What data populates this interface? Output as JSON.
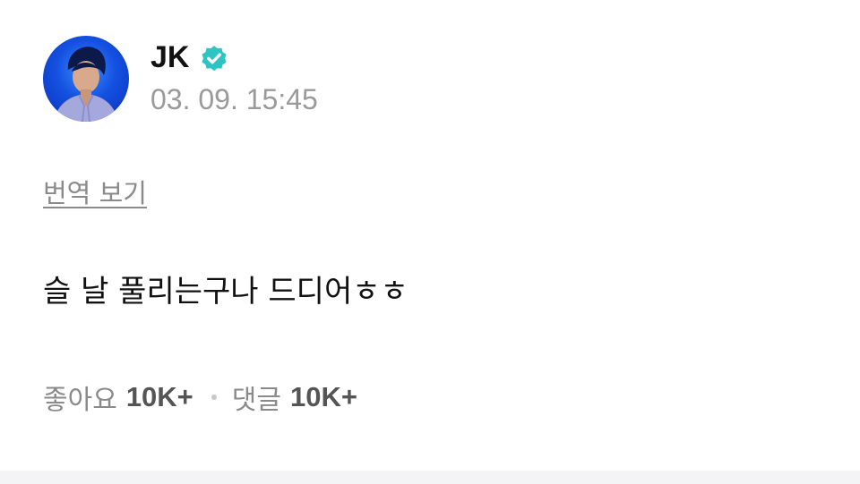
{
  "author": {
    "name": "JK",
    "verified_icon": "verified-badge-icon",
    "verified_color": "#2ec4c4",
    "avatar_bg_color": "#1450e0"
  },
  "post": {
    "timestamp": "03. 09. 15:45",
    "translate_label": "번역 보기",
    "body": "슬 날 풀리는구나 드디어ㅎㅎ"
  },
  "stats": {
    "likes_label": "좋아요",
    "likes_count": "10K+",
    "comments_label": "댓글",
    "comments_count": "10K+"
  },
  "colors": {
    "text_primary": "#111111",
    "text_secondary": "#8a8a8a",
    "divider_bar": "#f4f4f6"
  }
}
